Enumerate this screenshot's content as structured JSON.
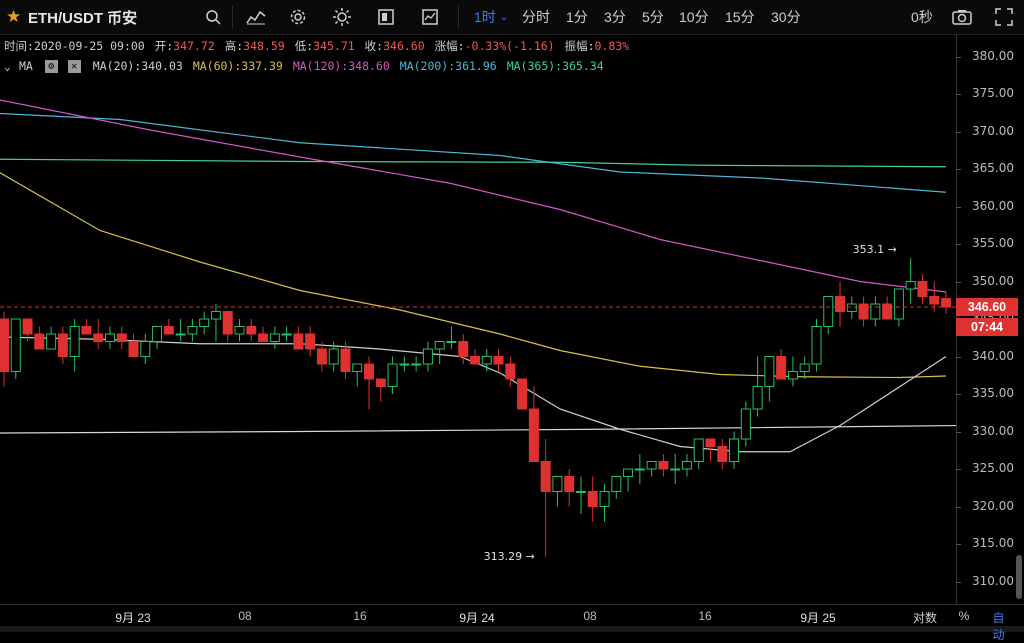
{
  "toolbar": {
    "star_icon": "star-icon",
    "symbol": "ETH/USDT 币安",
    "intervals": [
      "1时",
      "分时",
      "1分",
      "3分",
      "5分",
      "10分",
      "15分",
      "30分"
    ],
    "active_interval": "1时",
    "countdown": "0秒"
  },
  "info": {
    "time_label": "时间:",
    "time": "2020-09-25 09:00",
    "open_label": "开:",
    "open": "347.72",
    "high_label": "高:",
    "high": "348.59",
    "low_label": "低:",
    "low": "345.71",
    "close_label": "收:",
    "close": "346.60",
    "change_label": "涨幅:",
    "change": "-0.33%(-1.16)",
    "amp_label": "振幅:",
    "amp": "0.83%"
  },
  "ma_legend": {
    "label": "MA",
    "items": [
      {
        "text": "MA(20):340.03",
        "color": "#cfcfcf"
      },
      {
        "text": "MA(60):337.39",
        "color": "#d6c04a"
      },
      {
        "text": "MA(120):348.60",
        "color": "#d458c8"
      },
      {
        "text": "MA(200):361.96",
        "color": "#4fb6d8"
      },
      {
        "text": "MA(365):365.34",
        "color": "#3fd19a"
      }
    ]
  },
  "yaxis": [
    "380.00",
    "375.00",
    "370.00",
    "365.00",
    "360.00",
    "355.00",
    "350.00",
    "345.00",
    "340.00",
    "335.00",
    "330.00",
    "325.00",
    "320.00",
    "315.00",
    "310.00"
  ],
  "xaxis": [
    "9月 23",
    "08",
    "16",
    "9月 24",
    "08",
    "16",
    "9月 25"
  ],
  "current_price": "346.60",
  "countdown_tag": "07:44",
  "high_annotation": "353.1 →",
  "low_annotation": "313.29 →",
  "bottom": {
    "log_label": "对数",
    "pct_label": "%",
    "auto_label": "自动"
  },
  "colors": {
    "up": "#26c06a",
    "down": "#e03131",
    "accent": "#3d7bf5"
  },
  "chart_data": {
    "type": "candlestick",
    "ylim": [
      307,
      383
    ],
    "candles": [
      [
        345,
        346,
        336,
        338
      ],
      [
        338,
        345,
        337,
        345
      ],
      [
        345,
        345,
        342,
        343
      ],
      [
        343,
        344,
        341,
        341
      ],
      [
        341,
        344,
        341,
        343
      ],
      [
        343,
        344,
        339,
        340
      ],
      [
        340,
        345,
        338,
        344
      ],
      [
        344,
        345,
        343,
        343
      ],
      [
        343,
        345,
        341,
        342
      ],
      [
        342,
        344,
        341,
        343
      ],
      [
        343,
        344,
        341,
        342
      ],
      [
        342,
        343,
        340,
        340
      ],
      [
        340,
        343,
        339,
        342
      ],
      [
        342,
        344,
        341,
        344
      ],
      [
        344,
        345,
        343,
        343
      ],
      [
        343,
        345,
        342,
        343
      ],
      [
        343,
        345,
        342,
        344
      ],
      [
        344,
        346,
        343,
        345
      ],
      [
        345,
        347,
        342,
        346
      ],
      [
        346,
        346,
        342,
        343
      ],
      [
        343,
        345,
        342,
        344
      ],
      [
        344,
        345,
        342,
        343
      ],
      [
        343,
        344,
        342,
        342
      ],
      [
        342,
        344,
        341,
        343
      ],
      [
        343,
        344,
        342,
        343
      ],
      [
        343,
        344,
        342,
        341
      ],
      [
        343,
        344,
        340,
        341
      ],
      [
        341,
        342,
        338,
        339
      ],
      [
        339,
        342,
        338,
        341
      ],
      [
        341,
        342,
        337,
        338
      ],
      [
        338,
        339,
        336,
        339
      ],
      [
        339,
        340,
        333,
        337
      ],
      [
        337,
        337,
        334,
        336
      ],
      [
        336,
        340,
        335,
        339
      ],
      [
        339,
        340,
        338,
        339
      ],
      [
        339,
        340,
        338,
        339
      ],
      [
        339,
        342,
        338,
        341
      ],
      [
        341,
        342,
        339,
        342
      ],
      [
        342,
        344,
        341,
        342
      ],
      [
        342,
        343,
        339,
        340
      ],
      [
        340,
        341,
        339,
        339
      ],
      [
        339,
        341,
        338,
        340
      ],
      [
        340,
        341,
        338,
        339
      ],
      [
        339,
        340,
        336,
        337
      ],
      [
        337,
        337,
        333,
        333
      ],
      [
        333,
        336,
        326,
        326
      ],
      [
        326,
        329,
        313.29,
        322
      ],
      [
        322,
        324,
        320,
        324
      ],
      [
        324,
        325,
        320,
        322
      ],
      [
        322,
        324,
        319,
        322
      ],
      [
        322,
        324,
        318,
        320
      ],
      [
        320,
        323,
        318,
        322
      ],
      [
        322,
        324,
        321,
        324
      ],
      [
        324,
        325,
        322,
        325
      ],
      [
        325,
        327,
        323,
        325
      ],
      [
        325,
        326,
        324,
        326
      ],
      [
        326,
        327,
        324,
        325
      ],
      [
        325,
        327,
        323,
        325
      ],
      [
        325,
        327,
        324,
        326
      ],
      [
        326,
        329,
        325,
        329
      ],
      [
        329,
        329,
        326,
        328
      ],
      [
        328,
        329,
        325,
        326
      ],
      [
        326,
        330,
        325,
        329
      ],
      [
        329,
        334,
        328,
        333
      ],
      [
        333,
        340,
        332,
        336
      ],
      [
        336,
        338,
        334,
        340
      ],
      [
        340,
        341,
        337,
        337
      ],
      [
        337,
        340,
        336,
        338
      ],
      [
        338,
        340,
        337,
        339
      ],
      [
        339,
        345,
        338,
        344
      ],
      [
        344,
        348,
        343,
        348
      ],
      [
        348,
        350,
        344,
        346
      ],
      [
        346,
        348,
        345,
        347
      ],
      [
        347,
        348,
        344,
        345
      ],
      [
        345,
        348,
        344,
        347
      ],
      [
        347,
        348,
        345,
        345
      ],
      [
        345,
        349,
        344,
        349
      ],
      [
        349,
        353.1,
        347,
        350
      ],
      [
        350,
        351,
        347,
        348
      ],
      [
        348,
        350,
        346,
        347
      ],
      [
        347.72,
        348.59,
        345.71,
        346.6
      ]
    ]
  }
}
